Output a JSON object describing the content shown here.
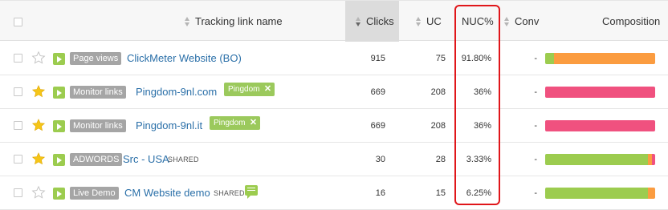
{
  "header": {
    "tracking_link_name": "Tracking link name",
    "clicks": "Clicks",
    "uc": "UC",
    "nuc": "NUC%",
    "conv": "Conv",
    "composition": "Composition"
  },
  "colors": {
    "link": "#2a6fa8",
    "green": "#9ccc4f",
    "orange": "#fb9c40",
    "pink": "#f0517f",
    "highlight": "#e0161a"
  },
  "rows": [
    {
      "starred": false,
      "group": "Page views",
      "name": "ClickMeter Website (BO)",
      "tag": "",
      "shared": "",
      "has_notes": false,
      "clicks": "915",
      "uc": "75",
      "nuc": "91.80%",
      "conv": "-",
      "composition": [
        {
          "color": "green",
          "pct": 8.2
        },
        {
          "color": "orange",
          "pct": 91.8
        }
      ]
    },
    {
      "starred": true,
      "group": "Monitor links",
      "name": "Pingdom-9nl.com",
      "tag": "Pingdom",
      "shared": "",
      "has_notes": false,
      "clicks": "669",
      "uc": "208",
      "nuc": "36%",
      "conv": "-",
      "composition": [
        {
          "color": "pink",
          "pct": 100
        }
      ]
    },
    {
      "starred": true,
      "group": "Monitor links",
      "name": "Pingdom-9nl.it",
      "tag": "Pingdom",
      "shared": "",
      "has_notes": false,
      "clicks": "669",
      "uc": "208",
      "nuc": "36%",
      "conv": "-",
      "composition": [
        {
          "color": "pink",
          "pct": 100
        }
      ]
    },
    {
      "starred": true,
      "group": "ADWORDS",
      "name": "Src - USA",
      "tag": "",
      "shared": "SHARED",
      "has_notes": false,
      "clicks": "30",
      "uc": "28",
      "nuc": "3.33%",
      "conv": "-",
      "composition": [
        {
          "color": "green",
          "pct": 93.5
        },
        {
          "color": "orange",
          "pct": 3.5
        },
        {
          "color": "pink",
          "pct": 3
        }
      ]
    },
    {
      "starred": false,
      "group": "Live Demo",
      "name": "CM Website demo",
      "tag": "",
      "shared": "SHARED",
      "has_notes": true,
      "clicks": "16",
      "uc": "15",
      "nuc": "6.25%",
      "conv": "-",
      "composition": [
        {
          "color": "green",
          "pct": 93.75
        },
        {
          "color": "orange",
          "pct": 6.25
        }
      ]
    }
  ]
}
